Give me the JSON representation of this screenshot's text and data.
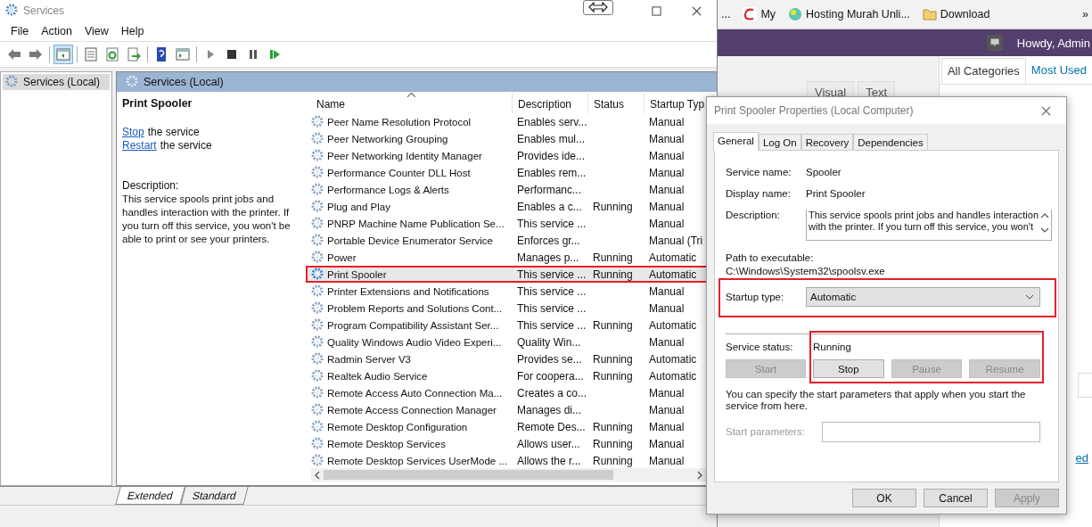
{
  "services_window": {
    "title": "Services",
    "menu": [
      "File",
      "Action",
      "View",
      "Help"
    ],
    "toolbar": [
      {
        "kind": "back"
      },
      {
        "kind": "forward"
      },
      {
        "kind": "sep"
      },
      {
        "kind": "tree",
        "selected": true
      },
      {
        "kind": "sep"
      },
      {
        "kind": "properties",
        "selected": false
      },
      {
        "kind": "refresh",
        "selected": false
      },
      {
        "kind": "export",
        "selected": false
      },
      {
        "kind": "sep"
      },
      {
        "kind": "help",
        "selected": false
      },
      {
        "kind": "console",
        "selected": false
      },
      {
        "kind": "sep"
      },
      {
        "kind": "play",
        "selected": false
      },
      {
        "kind": "stop",
        "selected": false
      },
      {
        "kind": "pause",
        "selected": false
      },
      {
        "kind": "resume",
        "selected": false
      }
    ],
    "tree": [
      {
        "label": "Services (Local)",
        "selected": true
      }
    ],
    "header": "Services (Local)",
    "detail": {
      "title": "Print Spooler",
      "actions": [
        {
          "link": "Stop",
          "text": "the service"
        },
        {
          "link": "Restart",
          "text": "the service"
        }
      ],
      "description_label": "Description:",
      "description": "This service spools print jobs and handles interaction with the printer. If you turn off this service, you won't be able to print or see your printers."
    },
    "columns": [
      {
        "label": "Name",
        "sorted": true
      },
      {
        "label": "Description",
        "sorted": false
      },
      {
        "label": "Status",
        "sorted": false
      },
      {
        "label": "Startup Typ",
        "sorted": false
      }
    ],
    "rows": [
      {
        "name": "Peer Name Resolution Protocol",
        "description": "Enables serv...",
        "status": "",
        "startup": "Manual",
        "selected": false,
        "highlighted": false
      },
      {
        "name": "Peer Networking Grouping",
        "description": "Enables mul...",
        "status": "",
        "startup": "Manual",
        "selected": false,
        "highlighted": false
      },
      {
        "name": "Peer Networking Identity Manager",
        "description": "Provides ide...",
        "status": "",
        "startup": "Manual",
        "selected": false,
        "highlighted": false
      },
      {
        "name": "Performance Counter DLL Host",
        "description": "Enables rem...",
        "status": "",
        "startup": "Manual",
        "selected": false,
        "highlighted": false
      },
      {
        "name": "Performance Logs & Alerts",
        "description": "Performanc...",
        "status": "",
        "startup": "Manual",
        "selected": false,
        "highlighted": false
      },
      {
        "name": "Plug and Play",
        "description": "Enables a c...",
        "status": "Running",
        "startup": "Manual",
        "selected": false,
        "highlighted": false
      },
      {
        "name": "PNRP Machine Name Publication Se...",
        "description": "This service ...",
        "status": "",
        "startup": "Manual",
        "selected": false,
        "highlighted": false
      },
      {
        "name": "Portable Device Enumerator Service",
        "description": "Enforces gr...",
        "status": "",
        "startup": "Manual (Tri",
        "selected": false,
        "highlighted": false
      },
      {
        "name": "Power",
        "description": "Manages p...",
        "status": "Running",
        "startup": "Automatic",
        "selected": false,
        "highlighted": false
      },
      {
        "name": "Print Spooler",
        "description": "This service ...",
        "status": "Running",
        "startup": "Automatic",
        "selected": true,
        "highlighted": true
      },
      {
        "name": "Printer Extensions and Notifications",
        "description": "This service ...",
        "status": "",
        "startup": "Manual",
        "selected": false,
        "highlighted": false
      },
      {
        "name": "Problem Reports and Solutions Cont...",
        "description": "This service ...",
        "status": "",
        "startup": "Manual",
        "selected": false,
        "highlighted": false
      },
      {
        "name": "Program Compatibility Assistant Ser...",
        "description": "This service ...",
        "status": "Running",
        "startup": "Automatic",
        "selected": false,
        "highlighted": false
      },
      {
        "name": "Quality Windows Audio Video Experi...",
        "description": "Quality Win...",
        "status": "",
        "startup": "Manual",
        "selected": false,
        "highlighted": false
      },
      {
        "name": "Radmin Server V3",
        "description": "Provides se...",
        "status": "Running",
        "startup": "Automatic",
        "selected": false,
        "highlighted": false
      },
      {
        "name": "Realtek Audio Service",
        "description": "For coopera...",
        "status": "Running",
        "startup": "Automatic",
        "selected": false,
        "highlighted": false
      },
      {
        "name": "Remote Access Auto Connection Ma...",
        "description": "Creates a co...",
        "status": "",
        "startup": "Manual",
        "selected": false,
        "highlighted": false
      },
      {
        "name": "Remote Access Connection Manager",
        "description": "Manages di...",
        "status": "",
        "startup": "Manual",
        "selected": false,
        "highlighted": false
      },
      {
        "name": "Remote Desktop Configuration",
        "description": "Remote Des...",
        "status": "Running",
        "startup": "Manual",
        "selected": false,
        "highlighted": false
      },
      {
        "name": "Remote Desktop Services",
        "description": "Allows user...",
        "status": "Running",
        "startup": "Manual",
        "selected": false,
        "highlighted": false
      },
      {
        "name": "Remote Desktop Services UserMode ...",
        "description": "Allows the r...",
        "status": "Running",
        "startup": "Manual",
        "selected": false,
        "highlighted": false
      }
    ],
    "view_tabs": [
      {
        "label": "Extended",
        "selected": true
      },
      {
        "label": "Standard",
        "selected": false
      }
    ]
  },
  "browser": {
    "bookmarks": [
      {
        "kind": "text",
        "label": "..."
      },
      {
        "kind": "site",
        "label": "My"
      },
      {
        "kind": "globe",
        "label": "Hosting Murah Unli..."
      },
      {
        "kind": "folder",
        "label": "Download"
      }
    ],
    "overflow": "»",
    "greeting": "Howdy, Admin",
    "editor_tabs": [
      "Visual",
      "Text"
    ],
    "category_tabs": [
      {
        "label": "All Categories",
        "selected": true
      },
      {
        "label": "Most Used",
        "selected": false
      }
    ],
    "link_fragment": "ed"
  },
  "dialog": {
    "title": "Print Spooler Properties (Local Computer)",
    "tabs": [
      {
        "label": "General",
        "selected": true
      },
      {
        "label": "Log On",
        "selected": false
      },
      {
        "label": "Recovery",
        "selected": false
      },
      {
        "label": "Dependencies",
        "selected": false
      }
    ],
    "service_name_label": "Service name:",
    "service_name": "Spooler",
    "display_name_label": "Display name:",
    "display_name": "Print Spooler",
    "description_label": "Description:",
    "description_lines": [
      "This service spools print jobs and handles interaction",
      "with the printer.  If you turn off this service, you won't"
    ],
    "path_label": "Path to executable:",
    "path": "C:\\Windows\\System32\\spoolsv.exe",
    "startup_label": "Startup type:",
    "startup_value": "Automatic",
    "startup_highlighted": true,
    "status_label": "Service status:",
    "status_value": "Running",
    "status_highlighted": true,
    "service_buttons": [
      {
        "label": "Start",
        "disabled": true
      },
      {
        "label": "Stop",
        "disabled": false
      },
      {
        "label": "Pause",
        "disabled": true
      },
      {
        "label": "Resume",
        "disabled": true
      }
    ],
    "note": "You can specify the start parameters that apply when you start the service from here.",
    "params_label": "Start parameters:",
    "params_disabled": true,
    "buttons": [
      {
        "label": "OK",
        "disabled": false
      },
      {
        "label": "Cancel",
        "disabled": false
      },
      {
        "label": "Apply",
        "disabled": true
      }
    ]
  }
}
